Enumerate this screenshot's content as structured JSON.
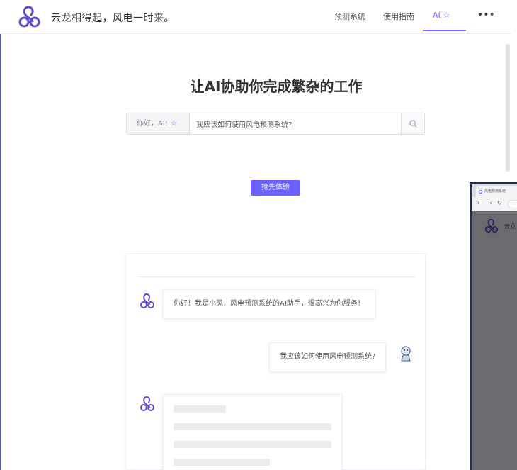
{
  "header": {
    "site_title": "云龙相得起，风电一时来。",
    "nav": {
      "item1": "预测系统",
      "item2": "使用指南",
      "item3": "AI ☆",
      "more": "•••"
    }
  },
  "hero": {
    "title": "让AI协助你完成繁杂的工作",
    "search": {
      "prefix_label": "你好，AI!",
      "prefix_icon": "star-icon",
      "value": "我应该如何使用风电预测系统?",
      "button_icon": "search-icon"
    },
    "cta_label": "抢先体验"
  },
  "chat": {
    "messages": [
      {
        "role": "bot",
        "text": "你好！我是小风，风电预测系统的AI助手，很高兴为你服务！"
      },
      {
        "role": "user",
        "text": "我应该如何使用风电预测系统?"
      },
      {
        "role": "bot",
        "text": ""
      }
    ]
  },
  "popup_window": {
    "tab_title": "风电预测系统",
    "page_title": "云龙"
  },
  "colors": {
    "accent": "#6c63ff",
    "popup_border": "#1f2d57",
    "popup_overlay": "#6b6b6f"
  }
}
